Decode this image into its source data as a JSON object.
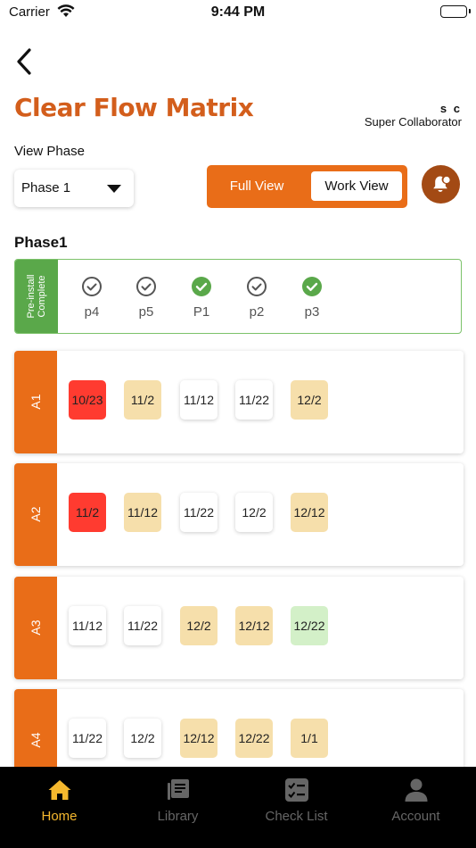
{
  "status_bar": {
    "carrier": "Carrier",
    "time": "9:44 PM"
  },
  "header": {
    "title": "Clear Flow Matrix",
    "user_initials": "s c",
    "user_role": "Super Collaborator"
  },
  "phase_picker": {
    "label": "View Phase",
    "selected": "Phase 1"
  },
  "view_toggle": {
    "full_view": "Full View",
    "work_view": "Work View",
    "selected": "Work View"
  },
  "phase": {
    "title": "Phase1",
    "pre_install": {
      "label": "Pre-install Complete",
      "items": [
        {
          "label": "p4",
          "status": "outline"
        },
        {
          "label": "p5",
          "status": "outline"
        },
        {
          "label": "P1",
          "status": "filled"
        },
        {
          "label": "p2",
          "status": "outline"
        },
        {
          "label": "p3",
          "status": "filled"
        }
      ]
    },
    "rows": [
      {
        "label": "A1",
        "dates": [
          "10/23",
          "11/2",
          "11/12",
          "11/22",
          "12/2"
        ],
        "status": [
          "red",
          "yellow",
          "white",
          "white",
          "yellow"
        ]
      },
      {
        "label": "A2",
        "dates": [
          "11/2",
          "11/12",
          "11/22",
          "12/2",
          "12/12"
        ],
        "status": [
          "red",
          "yellow",
          "white",
          "white",
          "yellow"
        ]
      },
      {
        "label": "A3",
        "dates": [
          "11/12",
          "11/22",
          "12/2",
          "12/12",
          "12/22"
        ],
        "status": [
          "white",
          "white",
          "yellow",
          "yellow",
          "green"
        ]
      },
      {
        "label": "A4",
        "dates": [
          "11/22",
          "12/2",
          "12/12",
          "12/22",
          "1/1"
        ],
        "status": [
          "white",
          "white",
          "yellow",
          "yellow",
          "yellow"
        ]
      }
    ]
  },
  "colors": {
    "brand": "#d35e1c",
    "accent": "#e96d18",
    "bell": "#a34a14",
    "check_green": "#5aa84a",
    "chip_red": "#ff3b30",
    "chip_yellow": "#f6dfab",
    "chip_green": "#d3f0c8",
    "nav_active": "#f5b82e"
  },
  "bottom_nav": {
    "items": [
      {
        "label": "Home",
        "icon": "home-icon",
        "active": true
      },
      {
        "label": "Library",
        "icon": "library-icon",
        "active": false
      },
      {
        "label": "Check List",
        "icon": "checklist-icon",
        "active": false
      },
      {
        "label": "Account",
        "icon": "account-icon",
        "active": false
      }
    ]
  }
}
